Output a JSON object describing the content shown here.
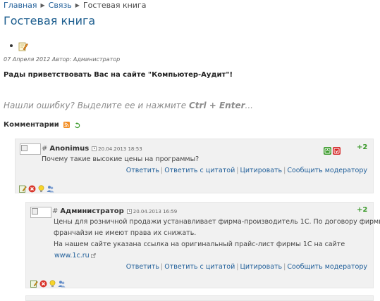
{
  "breadcrumb": {
    "home": "Главная",
    "section": "Связь",
    "current": "Гостевая книга"
  },
  "page": {
    "title": "Гостевая книга",
    "meta": "07 Апреля 2012 Автор: Администратор",
    "welcome": "Рады приветствовать Вас на сайте \"Компьютер-Аудит\"!",
    "typo_prefix": "Нашли ошибку? Выделите ее и нажмите ",
    "typo_keys": "Ctrl + Enter",
    "typo_suffix": "..."
  },
  "comments_title": "Комментарии",
  "actions": {
    "reply": "Ответить",
    "reply_quote": "Ответить с цитатой",
    "quote": "Цитировать",
    "report": "Сообщить модератору",
    "divider": "|"
  },
  "comments": [
    {
      "hash": "#",
      "author": "Anonimus",
      "date": "20.04.2013 18:53",
      "vote": "+2",
      "lines": [
        "Почему такие высокие цены на программы?"
      ]
    },
    {
      "hash": "#",
      "author": "Администратор",
      "date": "20.04.2013 16:59",
      "vote": "+2",
      "lines": [
        "Цены для розничной продажи устанавливает фирма-производитель 1С. По договору фирмы-",
        "франчайзи не имеют права их снижать.",
        "На нашем сайте указана ссылка на оригинальный прайс-лист фирмы 1С на сайте"
      ],
      "link": "www.1c.ru"
    }
  ],
  "colors": {
    "title": "#1d5e8f",
    "link": "#1f5e99",
    "vote": "#3c9a2c",
    "comment_bg": "#f1f1f1"
  },
  "icons": [
    "edit-icon",
    "rss-icon",
    "refresh-icon",
    "clock-icon",
    "vote-up-icon",
    "vote-down-icon",
    "edit-comment-icon",
    "delete-icon",
    "idea-icon",
    "users-icon",
    "external-link-icon"
  ]
}
